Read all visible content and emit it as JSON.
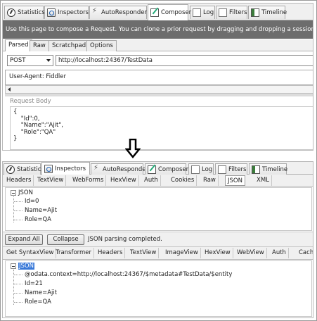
{
  "composer_window": {
    "tabs": [
      {
        "label": "Statistics",
        "icon": "statistics-icon"
      },
      {
        "label": "Inspectors",
        "icon": "inspectors-icon"
      },
      {
        "label": "AutoResponder",
        "icon": "lightning-icon"
      },
      {
        "label": "Composer",
        "icon": "composer-icon"
      },
      {
        "label": "Log",
        "icon": "log-icon"
      },
      {
        "label": "Filters",
        "icon": "checkbox-icon"
      },
      {
        "label": "Timeline",
        "icon": "timeline-icon"
      }
    ],
    "active_tab": "Composer",
    "info_text": "Use this page to compose a Request. You can clone a prior request by dragging and dropping a session fro",
    "subtabs": [
      "Parsed",
      "Raw",
      "Scratchpad",
      "Options"
    ],
    "active_subtab": "Parsed",
    "method": "POST",
    "url": "http://localhost:24367/TestData",
    "headers_text": "User-Agent: Fiddler",
    "request_body_label": "Request Body",
    "request_body": "{\n    \"Id\":0,\n    \"Name\":\"Ajit\",\n    \"Role\":\"QA\"\n}"
  },
  "inspector_window": {
    "tabs": [
      {
        "label": "Statistics",
        "icon": "statistics-icon"
      },
      {
        "label": "Inspectors",
        "icon": "inspectors-icon"
      },
      {
        "label": "AutoResponder",
        "icon": "lightning-icon"
      },
      {
        "label": "Composer",
        "icon": "composer-icon"
      },
      {
        "label": "Log",
        "icon": "log-icon"
      },
      {
        "label": "Filters",
        "icon": "checkbox-icon"
      },
      {
        "label": "Timeline",
        "icon": "timeline-icon"
      }
    ],
    "active_tab": "Inspectors",
    "request_tools": [
      "Headers",
      "TextView",
      "WebForms",
      "HexView",
      "Auth",
      "Cookies",
      "Raw",
      "JSON",
      "XML"
    ],
    "request_active_tool": "JSON",
    "request_tree": {
      "root": "JSON",
      "children": [
        "Id=0",
        "Name=Ajit",
        "Role=QA"
      ]
    },
    "expand_all_label": "Expand All",
    "collapse_label": "Collapse",
    "parse_status": "JSON parsing completed.",
    "response_tools": [
      "Get SyntaxView",
      "Transformer",
      "Headers",
      "TextView",
      "ImageView",
      "HexView",
      "WebView",
      "Auth",
      "Cachi"
    ],
    "response_tree": {
      "root": "JSON",
      "children": [
        "@odata.context=http://localhost:24367/$metadata#TestData/$entity",
        "Id=21",
        "Name=Ajit",
        "Role=QA"
      ]
    }
  }
}
